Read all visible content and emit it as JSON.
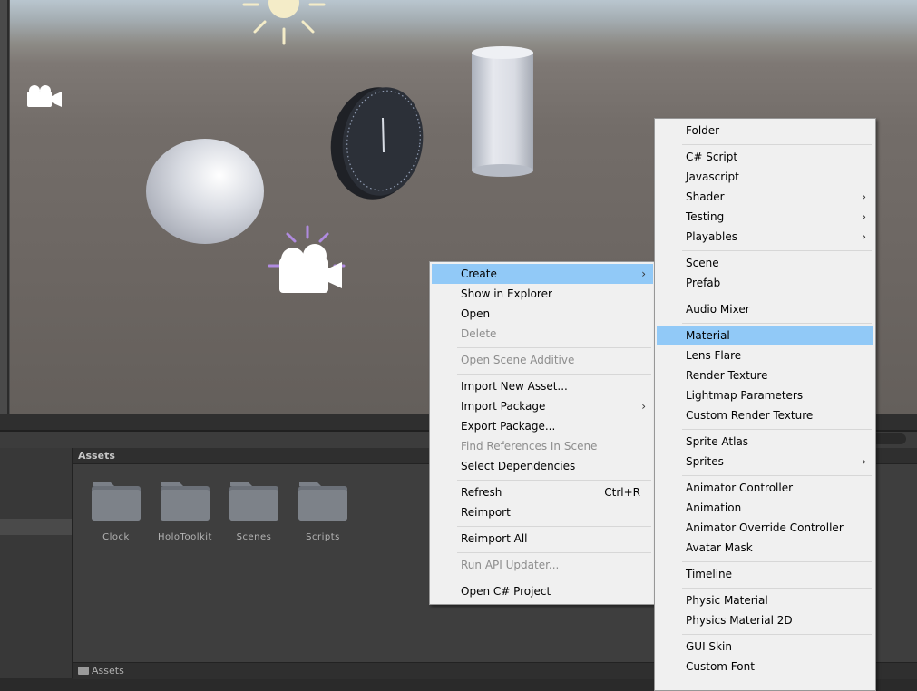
{
  "context_menu": {
    "items": [
      {
        "label": "Create",
        "submenu": true
      },
      {
        "label": "Show in Explorer"
      },
      {
        "label": "Open"
      },
      {
        "label": "Delete"
      },
      {
        "label": "Open Scene Additive"
      },
      {
        "label": "Import New Asset..."
      },
      {
        "label": "Import Package",
        "submenu": true
      },
      {
        "label": "Export Package..."
      },
      {
        "label": "Find References In Scene"
      },
      {
        "label": "Select Dependencies"
      },
      {
        "label": "Refresh",
        "shortcut": "Ctrl+R"
      },
      {
        "label": "Reimport"
      },
      {
        "label": "Reimport All"
      },
      {
        "label": "Run API Updater..."
      },
      {
        "label": "Open C# Project"
      }
    ]
  },
  "create_submenu": {
    "items": [
      {
        "label": "Folder"
      },
      {
        "label": "C# Script"
      },
      {
        "label": "Javascript"
      },
      {
        "label": "Shader",
        "submenu": true
      },
      {
        "label": "Testing",
        "submenu": true
      },
      {
        "label": "Playables",
        "submenu": true
      },
      {
        "label": "Scene"
      },
      {
        "label": "Prefab"
      },
      {
        "label": "Audio Mixer"
      },
      {
        "label": "Material"
      },
      {
        "label": "Lens Flare"
      },
      {
        "label": "Render Texture"
      },
      {
        "label": "Lightmap Parameters"
      },
      {
        "label": "Custom Render Texture"
      },
      {
        "label": "Sprite Atlas"
      },
      {
        "label": "Sprites",
        "submenu": true
      },
      {
        "label": "Animator Controller"
      },
      {
        "label": "Animation"
      },
      {
        "label": "Animator Override Controller"
      },
      {
        "label": "Avatar Mask"
      },
      {
        "label": "Timeline"
      },
      {
        "label": "Physic Material"
      },
      {
        "label": "Physics Material 2D"
      },
      {
        "label": "GUI Skin"
      },
      {
        "label": "Custom Font"
      }
    ]
  },
  "assets": {
    "title": "Assets",
    "folders": [
      "Clock",
      "HoloToolkit",
      "Scenes",
      "Scripts"
    ],
    "breadcrumb": "Assets"
  },
  "scene": {
    "icons": [
      "sun-icon",
      "camera-icon",
      "camera-gizmo-icon"
    ]
  },
  "colors": {
    "menu_bg": "#f0f0f0",
    "highlight": "#91c9f7",
    "disabled_text": "#8d8d8d",
    "assets_bg": "#3e3e3e"
  }
}
